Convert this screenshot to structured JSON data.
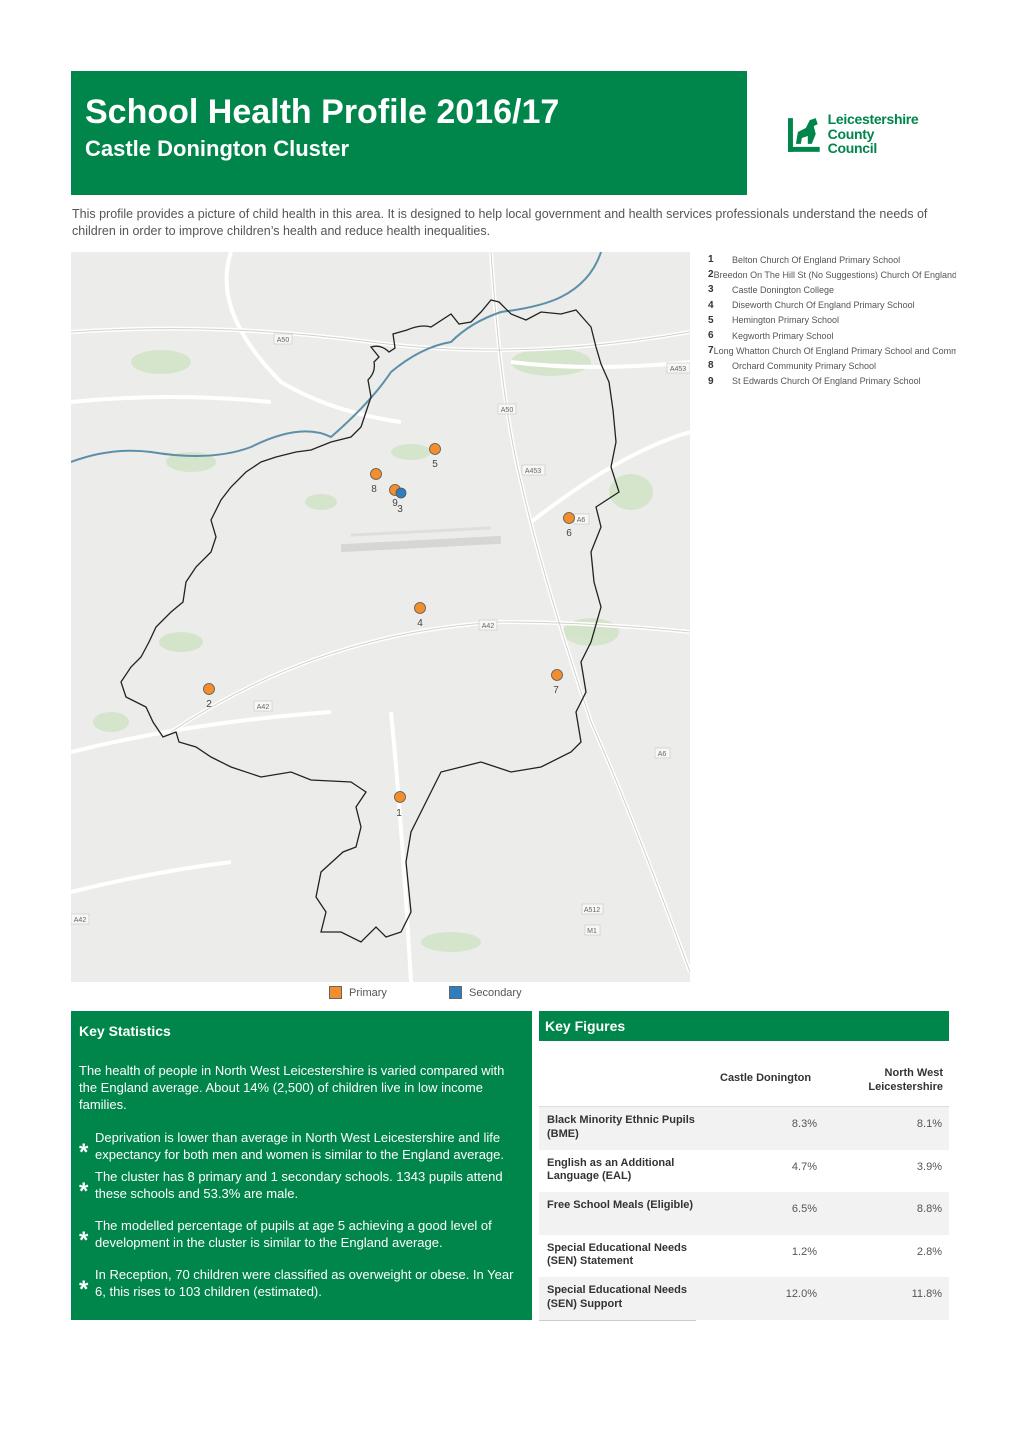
{
  "header": {
    "title": "School Health Profile 2016/17",
    "subtitle": "Castle Donington Cluster"
  },
  "logo": {
    "line1": "Leicestershire",
    "line2": "County Council"
  },
  "intro": "This profile provides a picture of child health in this area. It is designed to help local government and health services professionals understand the needs of children in order to improve children’s health and reduce health inequalities.",
  "schools": [
    {
      "num": "1",
      "name": "Belton Church Of England Primary School"
    },
    {
      "num": "2",
      "name": "Breedon On The Hill St (No Suggestions) Church Of England Primary School"
    },
    {
      "num": "3",
      "name": "Castle Donington College"
    },
    {
      "num": "4",
      "name": "Diseworth Church Of England Primary School"
    },
    {
      "num": "5",
      "name": "Hemington Primary School"
    },
    {
      "num": "6",
      "name": "Kegworth Primary School"
    },
    {
      "num": "7",
      "name": "Long Whatton Church Of England Primary School and Community Centre"
    },
    {
      "num": "8",
      "name": "Orchard Community Primary School"
    },
    {
      "num": "9",
      "name": "St Edwards Church Of England Primary School"
    }
  ],
  "map": {
    "roads": [
      "A50",
      "A453",
      "A50",
      "A453",
      "A6",
      "A42",
      "A42",
      "A6",
      "A512",
      "M1",
      "A42"
    ],
    "markers": [
      "1",
      "2",
      "3",
      "4",
      "5",
      "6",
      "7",
      "8",
      "9"
    ],
    "colors": {
      "primary": "#f28e2b",
      "secondary": "#2e7ebf"
    }
  },
  "map_legend": {
    "primary": "Primary",
    "secondary": "Secondary"
  },
  "key_statistics": {
    "title": "Key Statistics",
    "intro": "The health of people in North West Leicestershire is varied compared with the England average. About 14% (2,500) of children live in low income families.",
    "bullets": [
      "Deprivation is lower than average in North West Leicestershire and life expectancy for both men and women is similar to the England average.",
      "The cluster has 8 primary and 1 secondary schools.  1343 pupils attend these schools and 53.3% are male.",
      "The modelled percentage of pupils at age 5 achieving a good level of development in the cluster is similar to the England average.",
      "In Reception, 70 children were classified as overweight or obese.  In Year 6, this rises to 103 children (estimated)."
    ],
    "star": "*"
  },
  "key_figures": {
    "title": "Key Figures",
    "col1": "Castle Donington",
    "col2_line1": "North West",
    "col2_line2": "Leicestershire",
    "rows": [
      {
        "label": "Black Minority Ethnic Pupils (BME)",
        "v1": "8.3%",
        "v2": "8.1%"
      },
      {
        "label": "English as an Additional Language (EAL)",
        "v1": "4.7%",
        "v2": "3.9%"
      },
      {
        "label": "Free School Meals (Eligible)",
        "v1": "6.5%",
        "v2": "8.8%"
      },
      {
        "label": "Special Educational Needs (SEN) Statement",
        "v1": "1.2%",
        "v2": "2.8%"
      },
      {
        "label": "Special Educational Needs (SEN) Support",
        "v1": "12.0%",
        "v2": "11.8%"
      }
    ]
  },
  "colors": {
    "brand_green": "#00854a"
  }
}
